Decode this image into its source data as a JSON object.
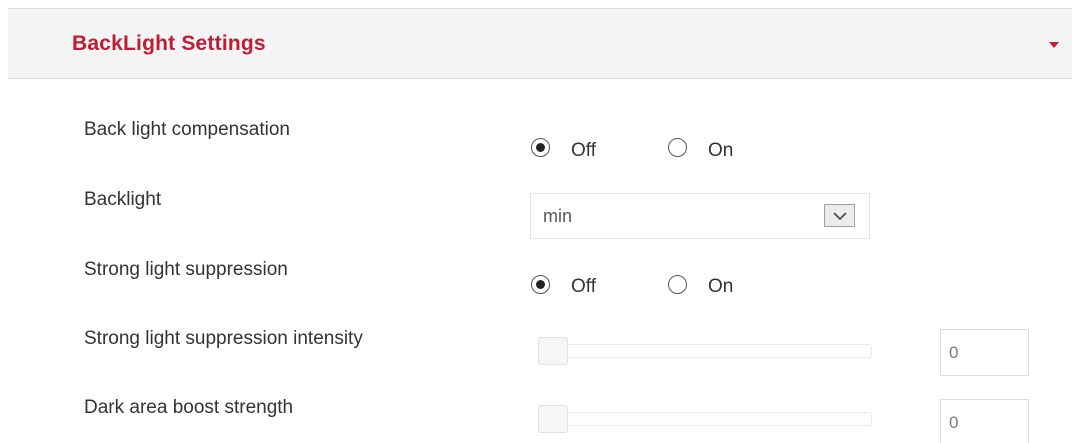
{
  "header": {
    "title": "BackLight Settings",
    "collapse_icon": "caret-down-icon",
    "accent_color": "#c01c33"
  },
  "back_light_compensation": {
    "label": "Back light compensation",
    "options": [
      "Off",
      "On"
    ],
    "selected": "Off"
  },
  "backlight": {
    "label": "Backlight",
    "value": "min",
    "dropdown_icon": "chevron-down-icon"
  },
  "strong_light_suppression": {
    "label": "Strong light suppression",
    "options": [
      "Off",
      "On"
    ],
    "selected": "Off"
  },
  "strong_light_suppression_intensity": {
    "label": "Strong light suppression intensity",
    "value": "0"
  },
  "dark_area_boost_strength": {
    "label": "Dark area boost strength",
    "value": "0"
  }
}
